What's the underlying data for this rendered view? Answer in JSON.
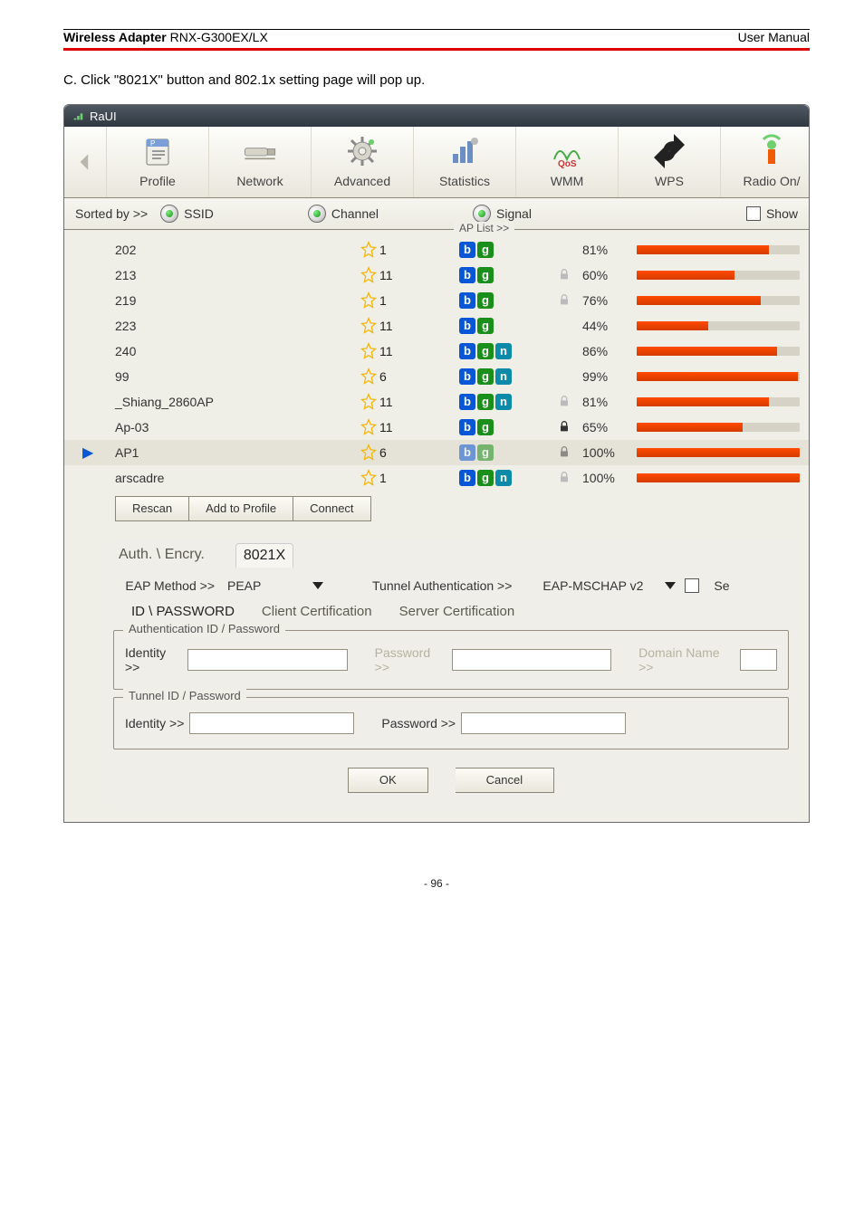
{
  "doc": {
    "product_left": "Wireless Adapter",
    "product_model": "RNX-G300EX/LX",
    "right": "User Manual",
    "intro": "C. Click \"8021X\" button and 802.1x setting page will pop up.",
    "page_no": "- 96 -"
  },
  "win": {
    "title": "RaUI"
  },
  "nav": {
    "profile": "Profile",
    "network": "Network",
    "advanced": "Advanced",
    "statistics": "Statistics",
    "wmm": "WMM",
    "wps": "WPS",
    "radio": "Radio On/"
  },
  "sort": {
    "label": "Sorted by >>",
    "ssid": "SSID",
    "channel": "Channel",
    "signal": "Signal",
    "show": "Show",
    "aplist": "AP List >>"
  },
  "aps": [
    {
      "ssid": "202",
      "ch": 1,
      "modes": [
        "b",
        "g"
      ],
      "sec": "none",
      "pct": 81
    },
    {
      "ssid": "213",
      "ch": 11,
      "modes": [
        "b",
        "g"
      ],
      "sec": "half",
      "pct": 60
    },
    {
      "ssid": "219",
      "ch": 1,
      "modes": [
        "b",
        "g"
      ],
      "sec": "half",
      "pct": 76
    },
    {
      "ssid": "223",
      "ch": 11,
      "modes": [
        "b",
        "g"
      ],
      "sec": "none",
      "pct": 44
    },
    {
      "ssid": "240",
      "ch": 11,
      "modes": [
        "b",
        "g",
        "n"
      ],
      "sec": "none",
      "pct": 86
    },
    {
      "ssid": "99",
      "ch": 6,
      "modes": [
        "b",
        "g",
        "n"
      ],
      "sec": "none",
      "pct": 99
    },
    {
      "ssid": "_Shiang_2860AP",
      "ch": 11,
      "modes": [
        "b",
        "g",
        "n"
      ],
      "sec": "half",
      "pct": 81
    },
    {
      "ssid": "Ap-03",
      "ch": 11,
      "modes": [
        "b",
        "g"
      ],
      "sec": "full",
      "pct": 65,
      "dark": true
    },
    {
      "ssid": "AP1",
      "ch": 6,
      "modes": [
        "b",
        "g"
      ],
      "sec": "full",
      "pct": 100,
      "selected": true,
      "faded": true
    },
    {
      "ssid": "arscadre",
      "ch": 1,
      "modes": [
        "b",
        "g",
        "n"
      ],
      "sec": "half",
      "pct": 100
    }
  ],
  "listbtns": {
    "rescan": "Rescan",
    "add": "Add to Profile",
    "connect": "Connect"
  },
  "cfg": {
    "tabs": {
      "auth": "Auth. \\ Encry.",
      "x": "8021X"
    },
    "eap_label": "EAP Method >>",
    "eap_value": "PEAP",
    "tunnel_label": "Tunnel Authentication >>",
    "tunnel_value": "EAP-MSCHAP v2",
    "se": "Se",
    "subtabs": {
      "idpw": "ID \\ PASSWORD",
      "clientcert": "Client Certification",
      "servercert": "Server Certification"
    },
    "grp1_legend": "Authentication ID / Password",
    "grp2_legend": "Tunnel ID / Password",
    "identity": "Identity >>",
    "password": "Password >>",
    "domain": "Domain Name >>",
    "ok": "OK",
    "cancel": "Cancel"
  }
}
